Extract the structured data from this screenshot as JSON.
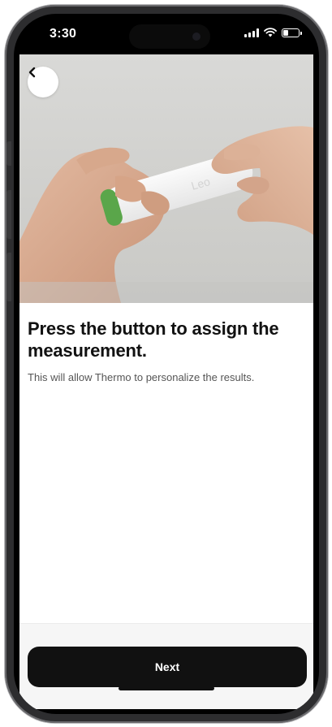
{
  "status_bar": {
    "time": "3:30",
    "icons": [
      "cellular-signal-icon",
      "wifi-icon",
      "battery-icon"
    ]
  },
  "navigation": {
    "back_icon": "chevron-left-icon"
  },
  "hero": {
    "image": "hands-holding-thermometer-photo",
    "device_logo_text": "Leo"
  },
  "content": {
    "headline": "Press the button to assign the measurement.",
    "subtext": "This will allow Thermo to personalize the results."
  },
  "footer": {
    "next_label": "Next"
  },
  "colors": {
    "primary_button": "#111111",
    "background": "#ffffff",
    "footer_background": "#f6f6f6",
    "device_accent": "#5aa64a"
  }
}
